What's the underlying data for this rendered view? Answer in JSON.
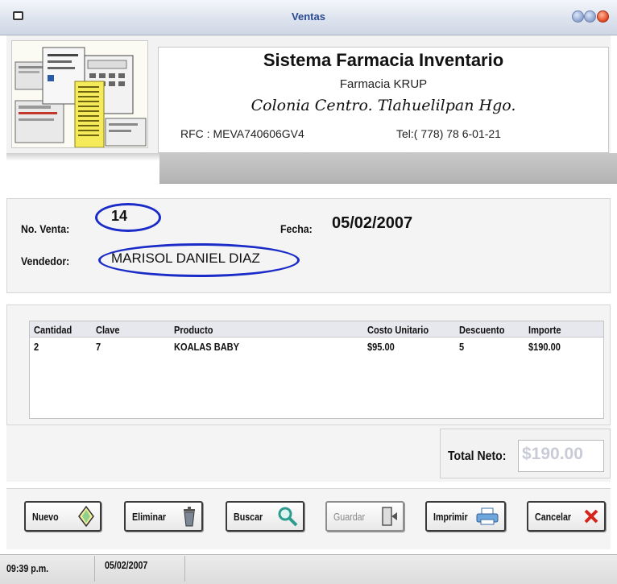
{
  "window": {
    "title": "Ventas"
  },
  "header": {
    "title": "Sistema Farmacia Inventario",
    "subtitle": "Farmacia KRUP",
    "address": "Colonia Centro. Tlahuelilpan Hgo.",
    "rfc": "RFC : MEVA740606GV4",
    "tel": "Tel:( 778) 78 6-01-21"
  },
  "sale": {
    "number_label": "No. Venta:",
    "number": "14",
    "date_label": "Fecha:",
    "date": "05/02/2007",
    "seller_label": "Vendedor:",
    "seller": "MARISOL DANIEL DIAZ"
  },
  "grid": {
    "columns": [
      "Cantidad",
      "Clave",
      "Producto",
      "Costo Unitario",
      "Descuento",
      "Importe"
    ],
    "rows": [
      [
        "2",
        "7",
        "KOALAS BABY",
        "$95.00",
        "5",
        "$190.00"
      ]
    ]
  },
  "total": {
    "label": "Total Neto:",
    "value": "$190.00"
  },
  "buttons": {
    "nuevo": "Nuevo",
    "eliminar": "Eliminar",
    "buscar": "Buscar",
    "guardar": "Guardar",
    "imprimir": "Imprimir",
    "cancelar": "Cancelar"
  },
  "status": {
    "time": "09:39 p.m.",
    "date": "05/02/2007"
  },
  "colors": {
    "accent_oval": "#1a2bc8",
    "title_text": "#2a4a8e",
    "total_disabled": "#c9cbd6"
  }
}
